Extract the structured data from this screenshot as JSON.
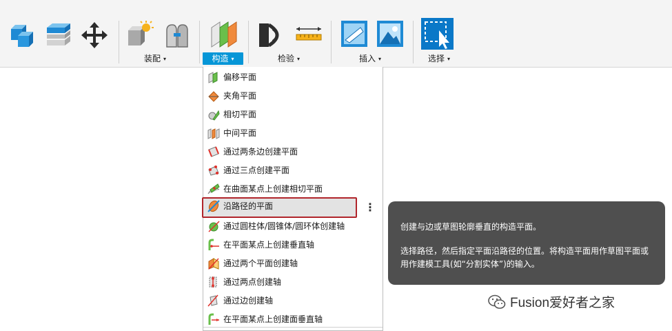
{
  "toolbar": {
    "groups": [
      {
        "label": "装配",
        "active": false
      },
      {
        "label": "构造",
        "active": true
      },
      {
        "label": "检验",
        "active": false
      },
      {
        "label": "插入",
        "active": false
      },
      {
        "label": "选择",
        "active": false
      }
    ],
    "caret": "▾"
  },
  "menu": {
    "items": [
      {
        "label": "偏移平面",
        "icon": "offset-plane-icon"
      },
      {
        "label": "夹角平面",
        "icon": "plane-at-angle-icon"
      },
      {
        "label": "相切平面",
        "icon": "tangent-plane-icon"
      },
      {
        "label": "中间平面",
        "icon": "midplane-icon"
      },
      {
        "label": "通过两条边创建平面",
        "icon": "plane-through-two-edges-icon"
      },
      {
        "label": "通过三点创建平面",
        "icon": "plane-through-three-points-icon"
      },
      {
        "label": "在曲面某点上创建相切平面",
        "icon": "plane-tangent-to-face-at-point-icon"
      },
      {
        "label": "沿路径的平面",
        "icon": "plane-along-path-icon",
        "highlighted": true
      },
      {
        "label": "通过圆柱体/圆锥体/圆环体创建轴",
        "icon": "axis-through-cylinder-icon"
      },
      {
        "label": "在平面某点上创建垂直轴",
        "icon": "axis-perpendicular-at-point-icon"
      },
      {
        "label": "通过两个平面创建轴",
        "icon": "axis-through-two-planes-icon"
      },
      {
        "label": "通过两点创建轴",
        "icon": "axis-through-two-points-icon"
      },
      {
        "label": "通过边创建轴",
        "icon": "axis-through-edge-icon"
      },
      {
        "label": "在平面某点上创建面垂直轴",
        "icon": "axis-perpendicular-to-face-icon"
      }
    ],
    "more_icon": "more-vertical-icon"
  },
  "tooltip": {
    "title": "创建与边或草图轮廓垂直的构造平面。",
    "body": "选择路径，然后指定平面沿路径的位置。将构造平面用作草图平面或用作建模工具(如“分割实体”)的输入。"
  },
  "watermark": {
    "text": "Fusion爱好者之家",
    "icon": "wechat-icon"
  },
  "colors": {
    "accent": "#0696d7",
    "highlight_border": "#b0242a",
    "tooltip_bg": "#4f4f4f"
  }
}
